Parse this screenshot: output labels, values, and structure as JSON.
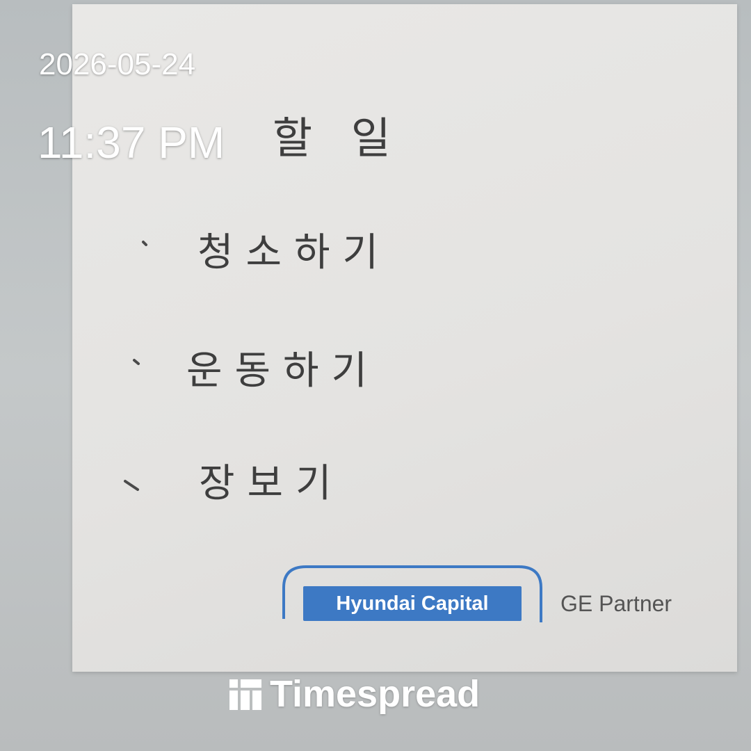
{
  "overlay": {
    "date": "2026-05-24",
    "time": "11:37 PM"
  },
  "note": {
    "title": "할 일",
    "items": [
      "청소하기",
      "운동하기",
      "장보기"
    ]
  },
  "print": {
    "brand": "Hyundai Capital",
    "partner": "GE Partner",
    "brand_color": "#3d79c4"
  },
  "watermark": {
    "text": "Timespread",
    "icon": "timespread-logo-icon"
  }
}
